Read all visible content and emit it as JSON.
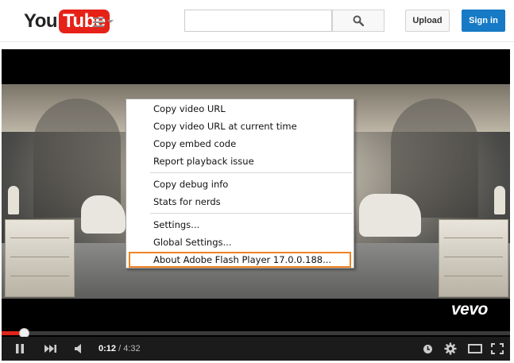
{
  "header": {
    "logo_you": "You",
    "logo_tube": "Tube",
    "search_placeholder": "",
    "upload_label": "Upload",
    "signin_label": "Sign in",
    "icons": [
      "guide-menu-icon",
      "search-icon"
    ]
  },
  "player": {
    "watermark": "vevo",
    "context_menu": {
      "items": [
        {
          "label": "Copy video URL"
        },
        {
          "label": "Copy video URL at current time"
        },
        {
          "label": "Copy embed code"
        },
        {
          "label": "Report playback issue"
        },
        {
          "label": "Copy debug info"
        },
        {
          "label": "Stats for nerds"
        },
        {
          "label": "Settings..."
        },
        {
          "label": "Global Settings..."
        },
        {
          "label": "About Adobe Flash Player 17.0.0.188..."
        }
      ],
      "highlighted_item": "About Adobe Flash Player 17.0.0.188..."
    },
    "controls": {
      "current_time": "0:12",
      "separator": " / ",
      "duration": "4:32",
      "progress_fraction": 0.044,
      "icons": [
        "pause-icon",
        "next-icon",
        "volume-icon",
        "watch-later-icon",
        "settings-gear-icon",
        "theater-mode-icon",
        "fullscreen-icon"
      ]
    }
  },
  "colors": {
    "brand_red": "#e62117",
    "signin_blue": "#167ac6",
    "highlight_orange": "#f08424",
    "progress_red": "#e1251b"
  }
}
